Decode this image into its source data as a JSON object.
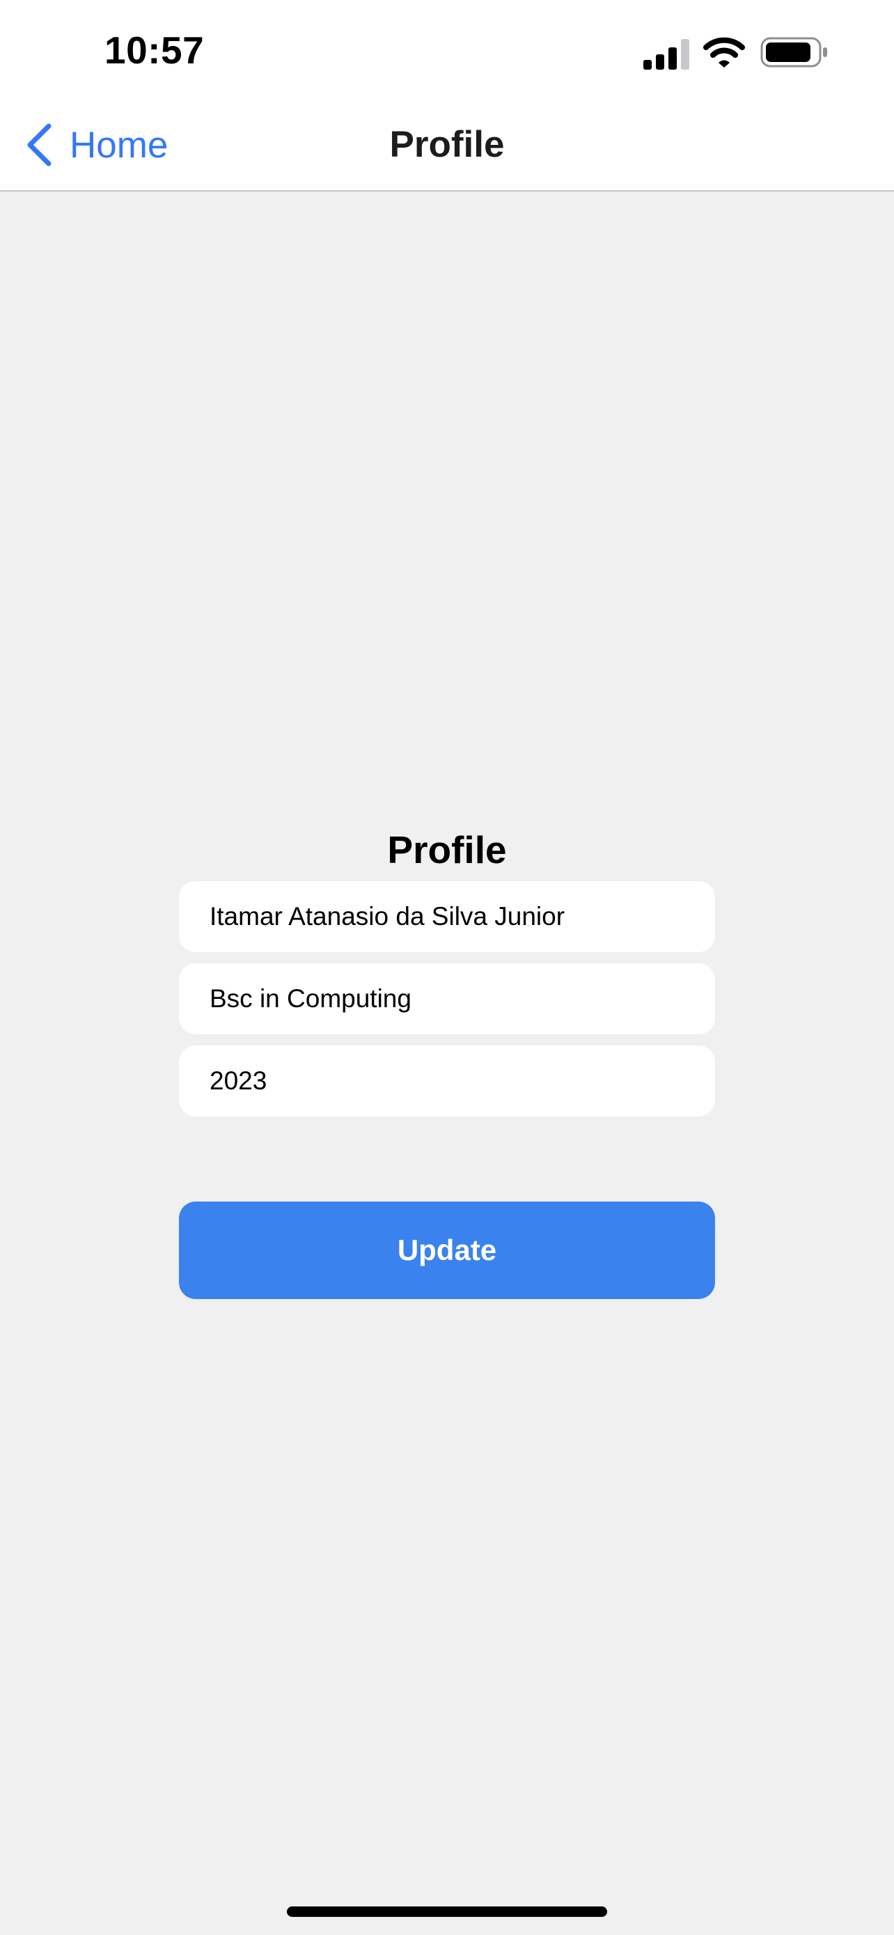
{
  "status_bar": {
    "time": "10:57"
  },
  "nav": {
    "back_label": "Home",
    "title": "Profile"
  },
  "profile": {
    "heading": "Profile",
    "name_value": "Itamar Atanasio da Silva Junior",
    "course_value": "Bsc in Computing",
    "year_value": "2023",
    "update_label": "Update"
  },
  "icons": {
    "back": "chevron-left-icon",
    "signal": "cellular-signal-icon",
    "wifi": "wifi-icon",
    "battery": "battery-icon"
  },
  "colors": {
    "accent": "#3478f6",
    "button": "#3a82ee",
    "background": "#f0f0f0"
  }
}
